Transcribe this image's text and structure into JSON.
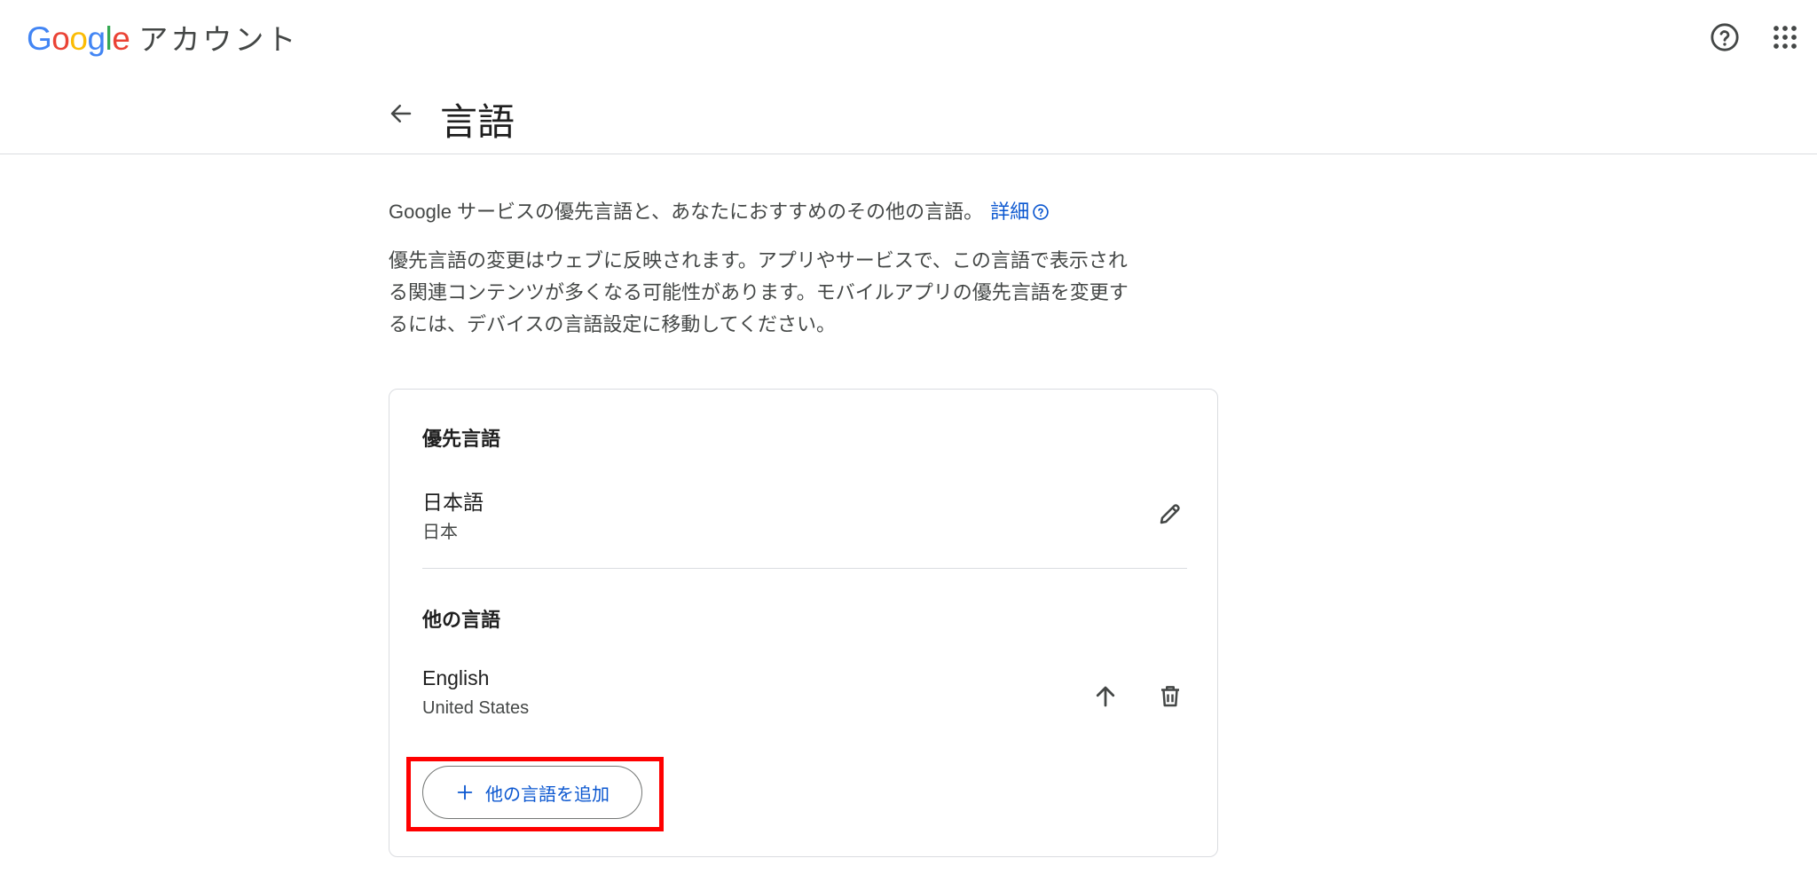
{
  "app": {
    "logo_text": [
      "G",
      "o",
      "o",
      "g",
      "l",
      "e"
    ],
    "logo_colors": [
      "#4285F4",
      "#EA4335",
      "#FBBC05",
      "#4285F4",
      "#34A853",
      "#EA4335"
    ],
    "product_name": "アカウント"
  },
  "header": {
    "title": "言語"
  },
  "intro": {
    "text": "Google サービスの優先言語と、あなたにおすすめのその他の言語。",
    "learn_more": "詳細"
  },
  "description": "優先言語の変更はウェブに反映されます。アプリやサービスで、この言語で表示される関連コンテンツが多くなる可能性があります。モバイルアプリの優先言語を変更するには、デバイスの言語設定に移動してください。",
  "preferred": {
    "section_title": "優先言語",
    "language": "日本語",
    "region": "日本"
  },
  "other": {
    "section_title": "他の言語",
    "languages": [
      {
        "language": "English",
        "region": "United States"
      }
    ],
    "add_button_label": "他の言語を追加"
  },
  "colors": {
    "accent": "#0b57d0",
    "highlight": "#ff0000",
    "icon": "#444746"
  }
}
